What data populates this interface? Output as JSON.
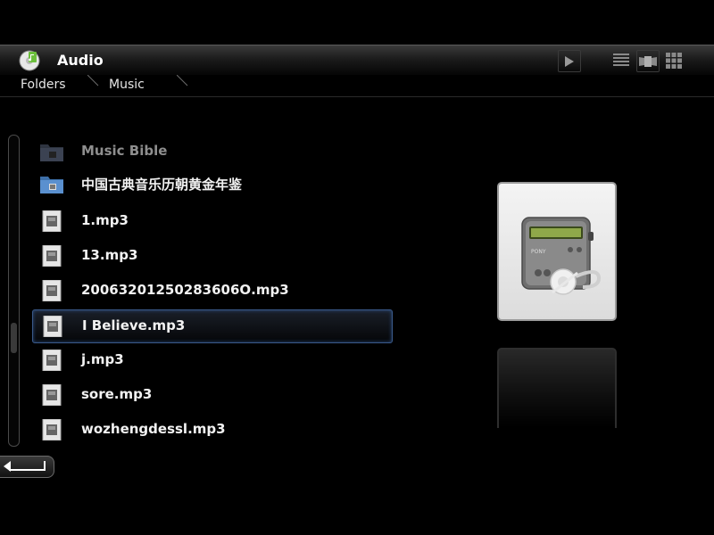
{
  "header": {
    "title": "Audio",
    "app_icon": "audio-app-icon",
    "buttons": [
      {
        "name": "play-button",
        "icon": "play-icon"
      },
      {
        "name": "list-view-button",
        "icon": "list-view-icon"
      },
      {
        "name": "coverflow-view-button",
        "icon": "coverflow-view-icon"
      },
      {
        "name": "grid-view-button",
        "icon": "grid-view-icon"
      }
    ]
  },
  "breadcrumb": {
    "items": [
      "Folders",
      "Music"
    ]
  },
  "list": {
    "items": [
      {
        "label": "Music Bible",
        "type": "folder",
        "state": "dim"
      },
      {
        "label": "中国古典音乐历朝黄金年鉴",
        "type": "folder",
        "state": "normal"
      },
      {
        "label": "1.mp3",
        "type": "file"
      },
      {
        "label": "13.mp3",
        "type": "file"
      },
      {
        "label": "20063201250283606О.mp3",
        "type": "file"
      },
      {
        "label": "I Believe.mp3",
        "type": "file",
        "selected": true
      },
      {
        "label": "j.mp3",
        "type": "file"
      },
      {
        "label": "sore.mp3",
        "type": "file"
      },
      {
        "label": "wozhengdessl.mp3",
        "type": "file"
      }
    ]
  },
  "preview": {
    "icon": "media-player-icon",
    "brand": "PONY"
  },
  "footer": {
    "back_icon": "back-arrow-icon"
  },
  "colors": {
    "selection_border": "#3a5a8a",
    "background": "#000000",
    "header_gradient_top": "#3a3a3a"
  }
}
